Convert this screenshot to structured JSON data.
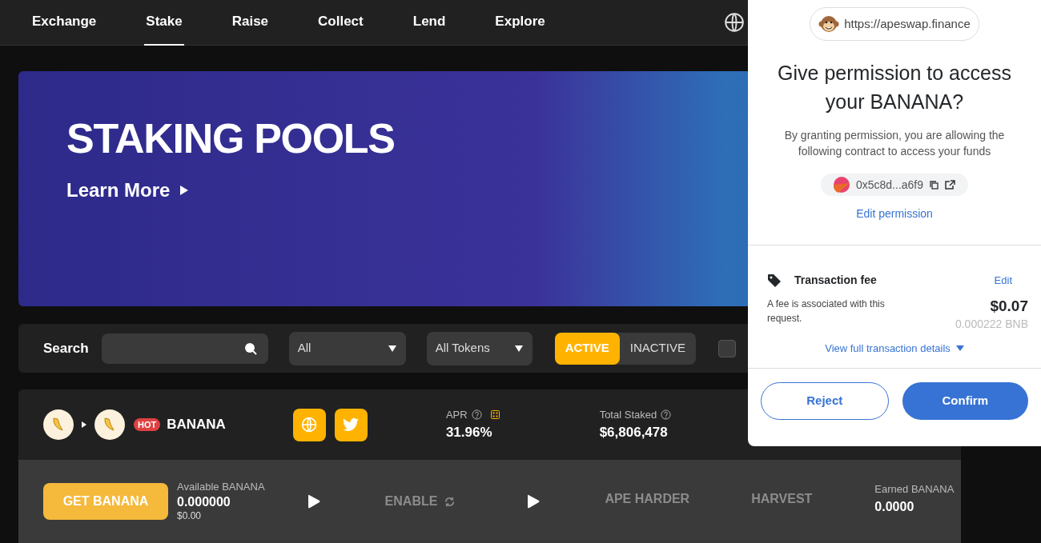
{
  "nav": {
    "items": [
      {
        "label": "Exchange",
        "selected": false
      },
      {
        "label": "Stake",
        "selected": true
      },
      {
        "label": "Raise",
        "selected": false
      },
      {
        "label": "Collect",
        "selected": false
      },
      {
        "label": "Lend",
        "selected": false
      },
      {
        "label": "Explore",
        "selected": false
      }
    ]
  },
  "banner": {
    "title": "STAKING POOLS",
    "link": "Learn More"
  },
  "filters": {
    "search_label": "Search",
    "selects": [
      "All",
      "All Tokens"
    ],
    "toggle": [
      {
        "label": "ACTIVE",
        "selected": true
      },
      {
        "label": "INACTIVE",
        "selected": false
      }
    ],
    "checkbox_checked": false
  },
  "pool": {
    "badge": "HOT",
    "name": "BANANA",
    "stats": [
      {
        "label": "APR",
        "value": "31.96%",
        "calculator": true
      },
      {
        "label": "Total Staked",
        "value": "$6,806,478",
        "calculator": false
      }
    ]
  },
  "actions": {
    "get_button": "GET BANANA",
    "available_label": "Available BANANA",
    "available_value": "0.000000",
    "available_usd": "$0.00",
    "steps": [
      {
        "label": "ENABLE",
        "disabled": true,
        "loading": true
      },
      {
        "label": "APE HARDER",
        "disabled": true,
        "loading": false
      },
      {
        "label": "HARVEST",
        "disabled": true,
        "loading": false
      }
    ],
    "earned_label": "Earned BANANA",
    "earned_value": "0.0000"
  },
  "popup": {
    "origin": "https://apeswap.finance",
    "title": "Give permission to access your BANANA?",
    "description": "By granting permission, you are allowing the following contract to access your funds",
    "contract": "0x5c8d...a6f9",
    "edit_permission": "Edit permission",
    "fee_label": "Transaction fee",
    "fee_edit": "Edit",
    "fee_description": "A fee is associated with this request.",
    "fee_usd": "$0.07",
    "fee_native": "0.000222 BNB",
    "details_link": "View full transaction details",
    "buttons": [
      {
        "label": "Reject",
        "kind": "secondary"
      },
      {
        "label": "Confirm",
        "kind": "primary"
      }
    ]
  }
}
